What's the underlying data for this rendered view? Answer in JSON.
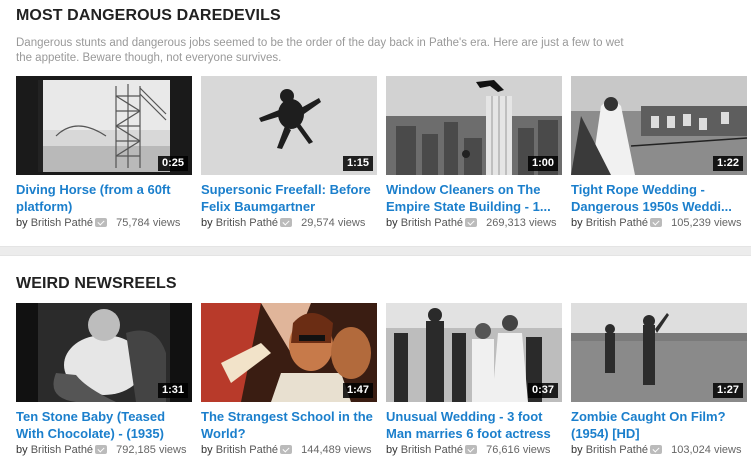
{
  "shelves": [
    {
      "title": "MOST DANGEROUS DAREDEVILS",
      "description": "Dangerous stunts and dangerous jobs seemed to be the order of the day back in Pathe's era. Here are just a few to wet the appetite. Beware though, not everyone survives.",
      "videos": [
        {
          "title": "Diving Horse (from a 60ft platform)",
          "duration": "0:25",
          "by": "by",
          "channel": "British Pathé",
          "views": "75,784 views"
        },
        {
          "title": "Supersonic Freefall: Before Felix Baumgartner",
          "duration": "1:15",
          "by": "by",
          "channel": "British Pathé",
          "views": "29,574 views"
        },
        {
          "title": "Window Cleaners on The Empire State Building - 1...",
          "duration": "1:00",
          "by": "by",
          "channel": "British Pathé",
          "views": "269,313 views"
        },
        {
          "title": "Tight Rope Wedding - Dangerous 1950s Weddi...",
          "duration": "1:22",
          "by": "by",
          "channel": "British Pathé",
          "views": "105,239 views"
        }
      ]
    },
    {
      "title": "WEIRD NEWSREELS",
      "description": "",
      "videos": [
        {
          "title": "Ten Stone Baby (Teased With Chocolate) - (1935)",
          "duration": "1:31",
          "by": "by",
          "channel": "British Pathé",
          "views": "792,185 views"
        },
        {
          "title": "The Strangest School in the World?",
          "duration": "1:47",
          "by": "by",
          "channel": "British Pathé",
          "views": "144,489 views"
        },
        {
          "title": "Unusual Wedding - 3 foot Man marries 6 foot actress",
          "duration": "0:37",
          "by": "by",
          "channel": "British Pathé",
          "views": "76,616 views"
        },
        {
          "title": "Zombie Caught On Film? (1954) [HD]",
          "duration": "1:27",
          "by": "by",
          "channel": "British Pathé",
          "views": "103,024 views"
        }
      ]
    }
  ],
  "icons": {
    "verified": "verified-check-icon"
  },
  "colors": {
    "link": "#1b7fcc",
    "divider": "#ececec",
    "description": "#999999"
  }
}
